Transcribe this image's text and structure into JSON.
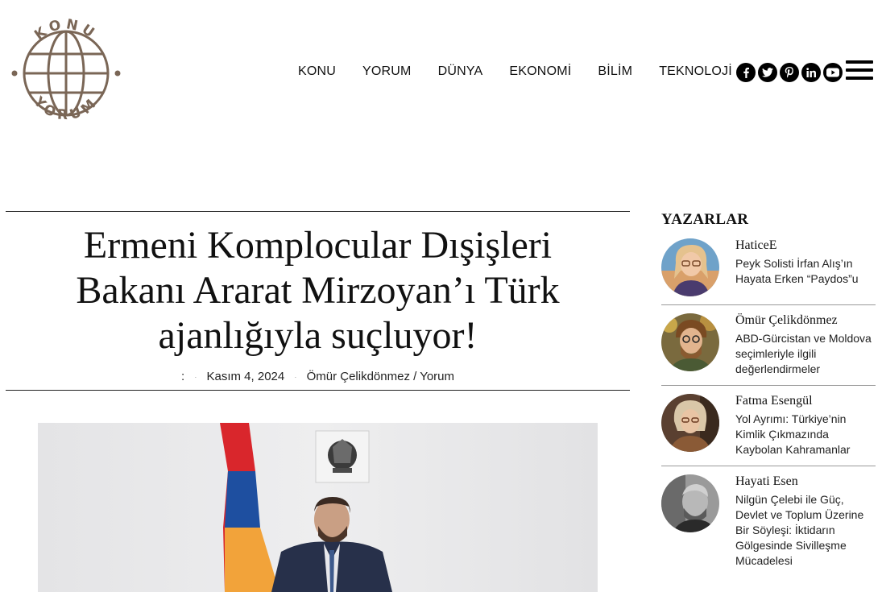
{
  "logo": {
    "top_text": "KONU",
    "bottom_text": "YORUM"
  },
  "nav": {
    "items": [
      "KONU",
      "YORUM",
      "DÜNYA",
      "EKONOMİ",
      "BİLİM",
      "TEKNOLOJİ"
    ]
  },
  "social": [
    "facebook-icon",
    "twitter-icon",
    "pinterest-icon",
    "linkedin-icon",
    "youtube-icon"
  ],
  "article": {
    "title": "Ermeni Komplocular Dışişleri Bakanı Ararat Mirzoyan’ı Türk ajanlığıyla suçluyor!",
    "meta_prefix": ":",
    "date": "Kasım 4, 2024",
    "author": "Ömür Çelikdönmez",
    "category_sep": "/",
    "category": "Yorum"
  },
  "sidebar": {
    "title": "YAZARLAR",
    "authors": [
      {
        "name": "HaticeE",
        "post": "Peyk Solisti İrfan Alış’ın Hayata Erken “Paydos”u"
      },
      {
        "name": "Ömür Çelikdönmez",
        "post": "ABD-Gürcistan ve Moldova seçimleriyle ilgili değerlendirmeler"
      },
      {
        "name": "Fatma Esengül",
        "post": "Yol Ayrımı: Türkiye’nin Kimlik Çıkmazında Kaybolan Kahramanlar"
      },
      {
        "name": "Hayati Esen",
        "post": "Nilgün Çelebi ile Güç, Devlet ve Toplum Üzerine Bir Söyleşi: İktidarın Gölgesinde Sivilleşme Mücadelesi"
      }
    ]
  },
  "colors": {
    "logo_brown": "#7a6656",
    "flag_red": "#d9262c",
    "flag_blue": "#1e4fa0",
    "flag_orange": "#f2a33a"
  }
}
